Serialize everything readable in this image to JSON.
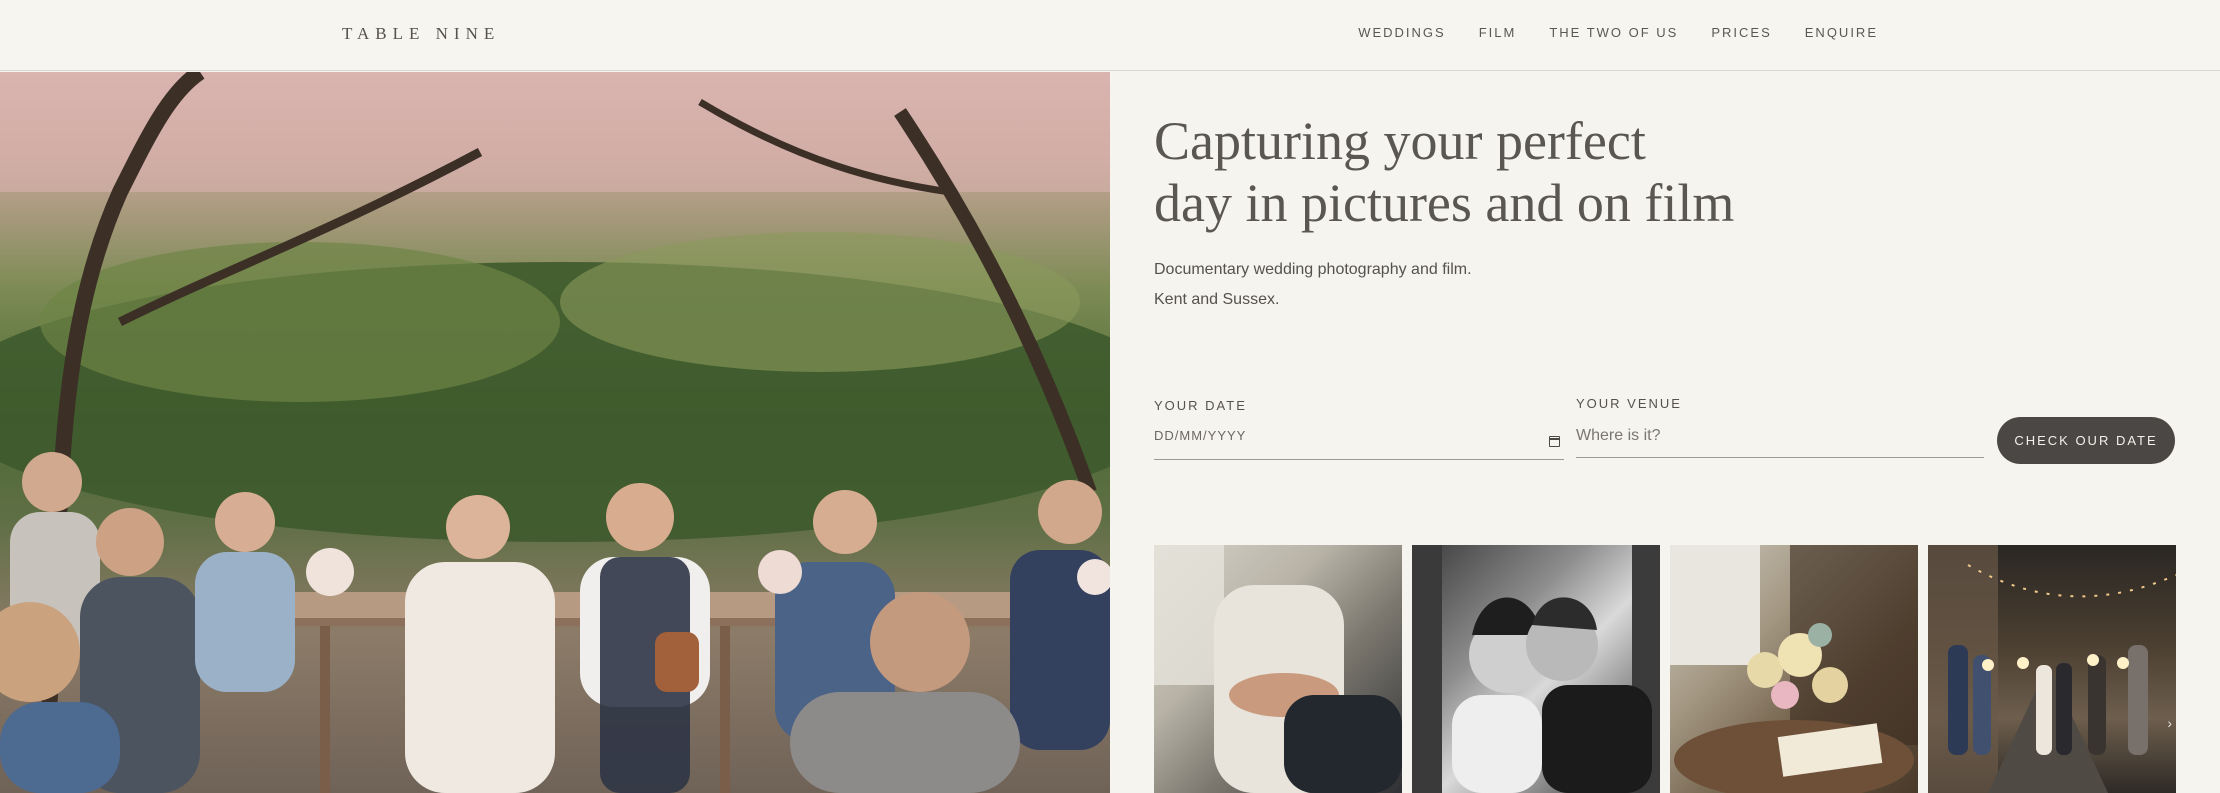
{
  "brand": {
    "logo": "TABLE NINE"
  },
  "nav": {
    "items": [
      "WEDDINGS",
      "FILM",
      "THE TWO OF US",
      "PRICES",
      "ENQUIRE"
    ]
  },
  "hero": {
    "headline_line1": "Capturing your perfect",
    "headline_line2": "day in pictures and on film",
    "sub_line1": "Documentary wedding photography and film.",
    "sub_line2": "Kent and Sussex."
  },
  "form": {
    "date_label": "YOUR DATE",
    "date_placeholder": "DD/MM/YYYY",
    "venue_label": "YOUR VENUE",
    "venue_placeholder": "Where is it?",
    "submit_label": "CHECK OUR DATE"
  },
  "icons": {
    "date": "calendar-icon",
    "gallery_next": "chevron-right-icon"
  },
  "colors": {
    "background": "#f6f4ef",
    "button": "#4a4744",
    "text": "#4a4743"
  }
}
